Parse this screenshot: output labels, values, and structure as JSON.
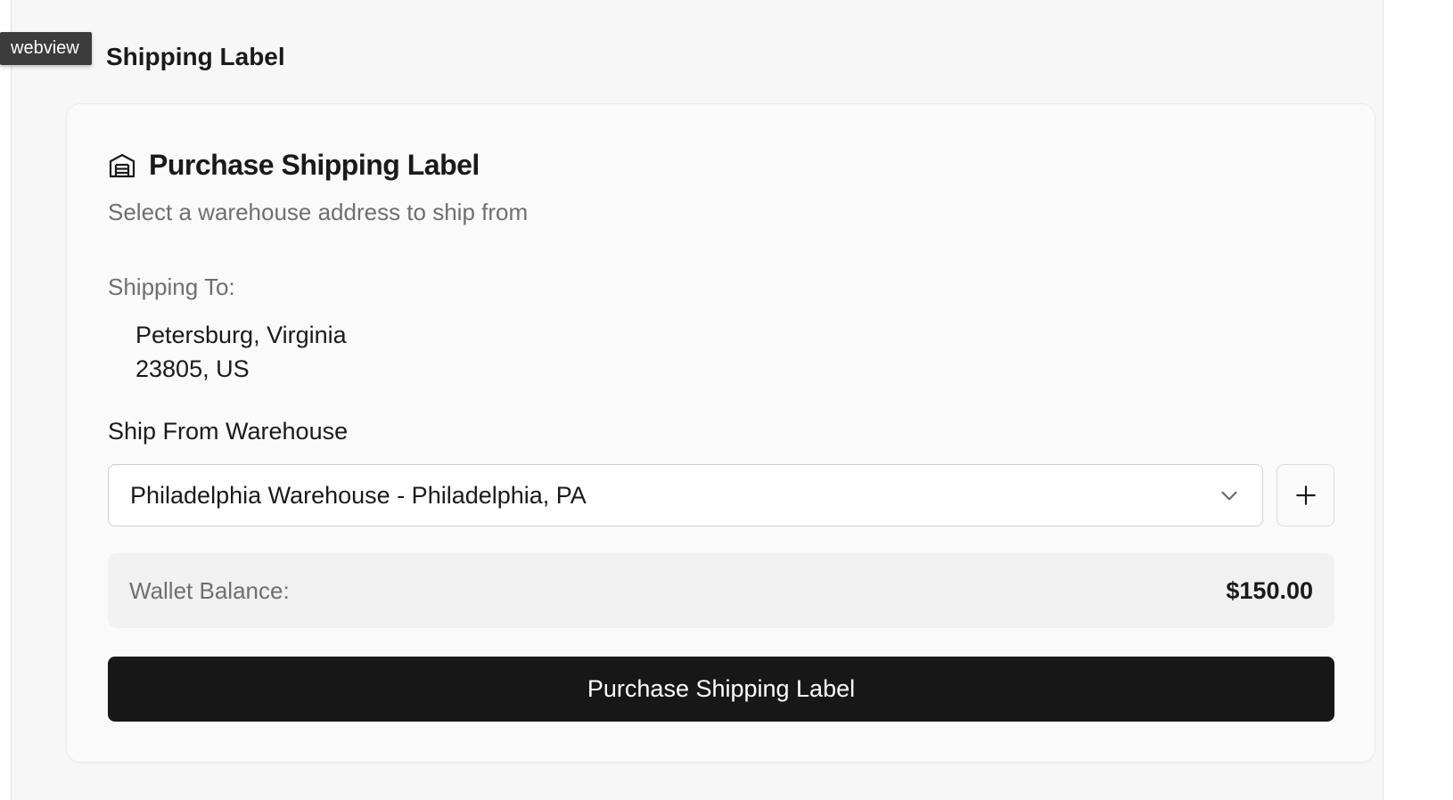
{
  "overlay": {
    "webview_tag": "webview"
  },
  "section": {
    "title": "Shipping Label",
    "icon": "label-icon"
  },
  "card": {
    "icon": "warehouse-icon",
    "title": "Purchase Shipping Label",
    "subtitle": "Select a warehouse address to ship from",
    "shipping_to_label": "Shipping To:",
    "address": {
      "line1": "Petersburg, Virginia",
      "line2": "23805, US"
    },
    "ship_from_label": "Ship From Warehouse",
    "warehouse_select": {
      "selected": "Philadelphia Warehouse - Philadelphia, PA",
      "icon": "chevron-down-icon"
    },
    "add_button_icon": "plus-icon",
    "wallet": {
      "label": "Wallet Balance:",
      "value": "$150.00"
    },
    "purchase_button_label": "Purchase Shipping Label"
  },
  "colors": {
    "page_bg": "#f7f7f7",
    "card_bg": "#fafafa",
    "primary_button": "#171717",
    "muted_text": "#6f6f6f"
  }
}
